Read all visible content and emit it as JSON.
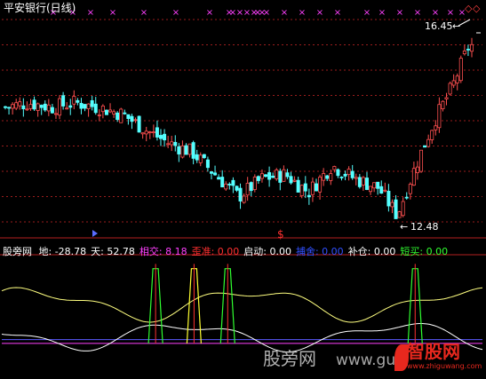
{
  "window": {
    "title": "平安银行(日线)"
  },
  "upper_panel": {
    "high_label": "16.45",
    "low_label": "12.48",
    "high_marker": "←",
    "low_marker": "←",
    "diamond_marker": "◇",
    "cross_marker": "×",
    "dollar_marker": "$"
  },
  "lower_panel": {
    "indicator_name": "股旁网",
    "readouts": [
      {
        "label": "地:",
        "value": "-28.78",
        "color": "#ffffff"
      },
      {
        "label": "天:",
        "value": "52.78",
        "color": "#ffffff"
      },
      {
        "label": "相交:",
        "value": "8.18",
        "color": "#ff40ff"
      },
      {
        "label": "歪准:",
        "value": "0.00",
        "color": "#ff3030"
      },
      {
        "label": "启动:",
        "value": "0.00",
        "color": "#ffffff"
      },
      {
        "label": "捕舍:",
        "value": "0.00",
        "color": "#3050ff"
      },
      {
        "label": "补仓:",
        "value": "0.00",
        "color": "#ffffff"
      },
      {
        "label": "短买:",
        "value": "0.00",
        "color": "#30ff30"
      }
    ]
  },
  "watermark": {
    "left_text": "股旁网",
    "url_text": "www.gu",
    "logo_text": "智股网",
    "logo_url": "www.zhiguwang.com"
  },
  "chart_data": [
    {
      "type": "candlestick",
      "title": "平安银行(日线)",
      "ylim": [
        12.1,
        16.9
      ],
      "annotated_high": 16.45,
      "annotated_low": 12.48,
      "close_path": [
        [
          0,
          14.9
        ],
        [
          0.05,
          15.0
        ],
        [
          0.1,
          14.9
        ],
        [
          0.15,
          15.0
        ],
        [
          0.2,
          14.9
        ],
        [
          0.25,
          14.75
        ],
        [
          0.3,
          14.4
        ],
        [
          0.35,
          14.1
        ],
        [
          0.4,
          13.9
        ],
        [
          0.45,
          13.4
        ],
        [
          0.5,
          12.9
        ],
        [
          0.55,
          13.3
        ],
        [
          0.6,
          13.4
        ],
        [
          0.65,
          13.0
        ],
        [
          0.7,
          13.6
        ],
        [
          0.75,
          13.3
        ],
        [
          0.8,
          13.1
        ],
        [
          0.84,
          12.48
        ],
        [
          0.88,
          13.6
        ],
        [
          0.92,
          14.6
        ],
        [
          0.96,
          15.4
        ],
        [
          1.0,
          16.45
        ]
      ],
      "cross_markers_count": 26,
      "colors": {
        "up": "#ff5050",
        "down": "#54ffff"
      }
    },
    {
      "type": "line",
      "ylim": [
        -40,
        65
      ],
      "series": [
        {
          "name": "天",
          "color": "#ffff80",
          "last": 52.78
        },
        {
          "name": "地",
          "color": "#ffffff",
          "last": -28.78
        },
        {
          "name": "相交",
          "color": "#ff40ff",
          "last": 8.18
        }
      ],
      "signal_blocks": [
        {
          "at": 0.32,
          "color": "#30ff30"
        },
        {
          "at": 0.4,
          "color": "#ffff30"
        },
        {
          "at": 0.47,
          "color": "#30ff30"
        },
        {
          "at": 0.86,
          "color": "#30ff30"
        }
      ]
    }
  ]
}
